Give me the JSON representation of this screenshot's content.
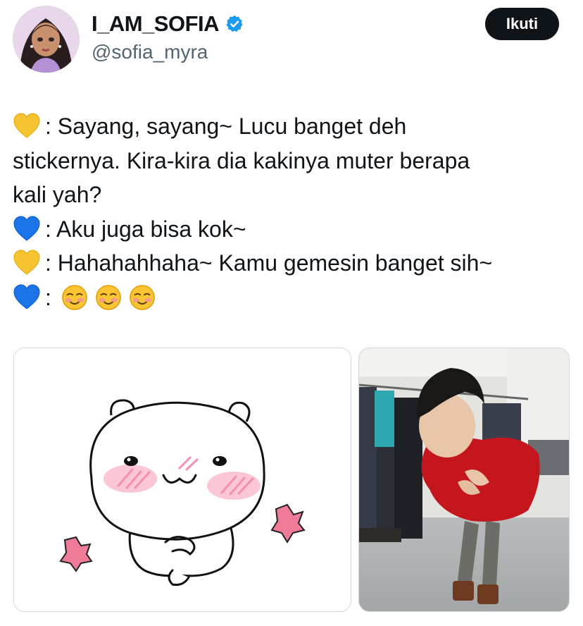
{
  "author": {
    "display_name": "I_AM_SOFIA",
    "handle": "@sofia_myra",
    "verified": true,
    "verified_color": "#1d9bf0"
  },
  "follow_button": {
    "label": "Ikuti"
  },
  "tweet": {
    "lines": [
      {
        "icon": "yellow-heart-icon",
        "text": ": Sayang, sayang~ Lucu banget deh"
      },
      {
        "icon": "",
        "text": "stickernya. Kira-kira dia kakinya muter berapa"
      },
      {
        "icon": "",
        "text": "kali yah?"
      },
      {
        "icon": "blue-heart-icon",
        "text": ": Aku juga bisa kok~"
      },
      {
        "icon": "yellow-heart-icon",
        "text": ": Hahahahhaha~ Kamu gemesin banget sih~"
      },
      {
        "icon": "blue-heart-icon",
        "text": ":",
        "emojis": [
          "smiling-face-icon",
          "smiling-face-icon",
          "smiling-face-icon"
        ]
      }
    ]
  },
  "media": [
    {
      "kind": "sticker",
      "subject": "white bear sticker with pink blush"
    },
    {
      "kind": "photo",
      "subject": "person in red sweater in wardrobe room"
    }
  ],
  "colors": {
    "yellow_heart": "#f7c431",
    "blue_heart": "#1c74e9",
    "follow_bg": "#0f1419",
    "handle": "#536471"
  }
}
